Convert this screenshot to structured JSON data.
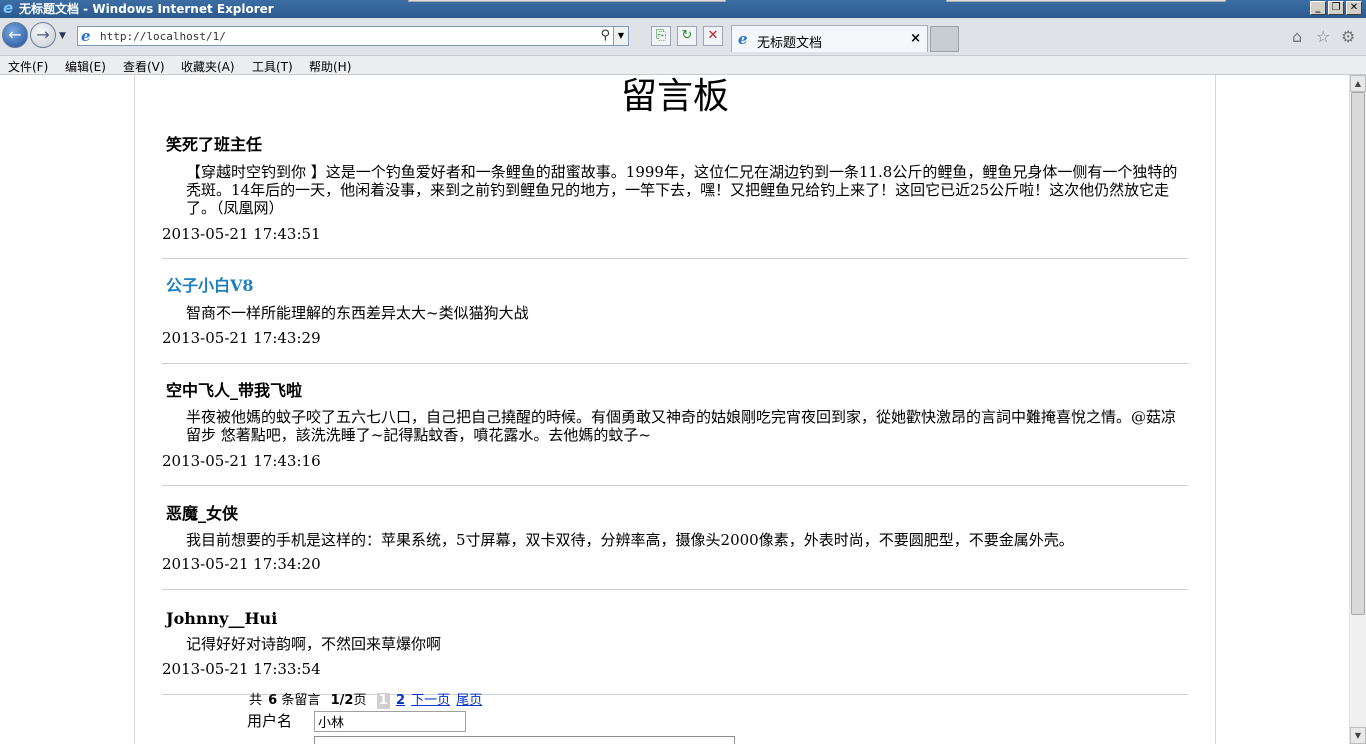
{
  "window": {
    "title": "无标题文档 - Windows Internet Explorer",
    "minimize_glyph": "_",
    "restore_glyph": "❐",
    "close_glyph": "✕"
  },
  "nav": {
    "url": "http://localhost/1/",
    "tab_title": "无标题文档",
    "tab_close": "×"
  },
  "menu": {
    "file": "文件(F)",
    "edit": "编辑(E)",
    "view": "查看(V)",
    "favorites": "收藏夹(A)",
    "tools": "工具(T)",
    "help": "帮助(H)"
  },
  "page": {
    "title": "留言板",
    "messages": [
      {
        "author": "笑死了班主任",
        "content": "【穿越时空钓到你 】这是一个钓鱼爱好者和一条鲤鱼的甜蜜故事。1999年，这位仁兄在湖边钓到一条11.8公斤的鲤鱼，鲤鱼兄身体一侧有一个独特的秃斑。14年后的一天，他闲着没事，来到之前钓到鲤鱼兄的地方，一竿下去，嘿！又把鲤鱼兄给钓上来了！这回它已近25公斤啦！这次他仍然放它走了。（凤凰网）",
        "time": "2013-05-21 17:43:51"
      },
      {
        "author": "公子小白V8",
        "content": "智商不一样所能理解的东西差异太大~类似猫狗大战",
        "time": "2013-05-21 17:43:29"
      },
      {
        "author": "空中飞人_带我飞啦",
        "content": "半夜被他媽的蚊子咬了五六七八口，自己把自己撓醒的時候。有個勇敢又神奇的姑娘剛吃完宵夜回到家，從她歡快激昂的言詞中難掩喜悅之情。@菇凉留步 悠著點吧，該洗洗睡了~記得點蚊香，噴花露水。去他媽的蚊子~",
        "time": "2013-05-21 17:43:16"
      },
      {
        "author": "恶魔_女侠",
        "content": "我目前想要的手机是这样的：苹果系统，5寸屏幕，双卡双待，分辨率高，摄像头2000像素，外表时尚，不要圆肥型，不要金属外壳。",
        "time": "2013-05-21 17:34:20"
      },
      {
        "author": "Johnny__Hui",
        "content": "记得好好对诗韵啊，不然回来草爆你啊",
        "time": "2013-05-21 17:33:54"
      }
    ],
    "pager": {
      "total_prefix": "共",
      "total_count": "6",
      "total_suffix": "条留言",
      "page_info_bold": "1/2",
      "page_info_suffix": "页",
      "current_page": "1",
      "next_page_num": "2",
      "next_label": "下一页",
      "last_label": "尾页"
    },
    "form": {
      "username_label": "用户名",
      "username_value": "小林"
    }
  }
}
